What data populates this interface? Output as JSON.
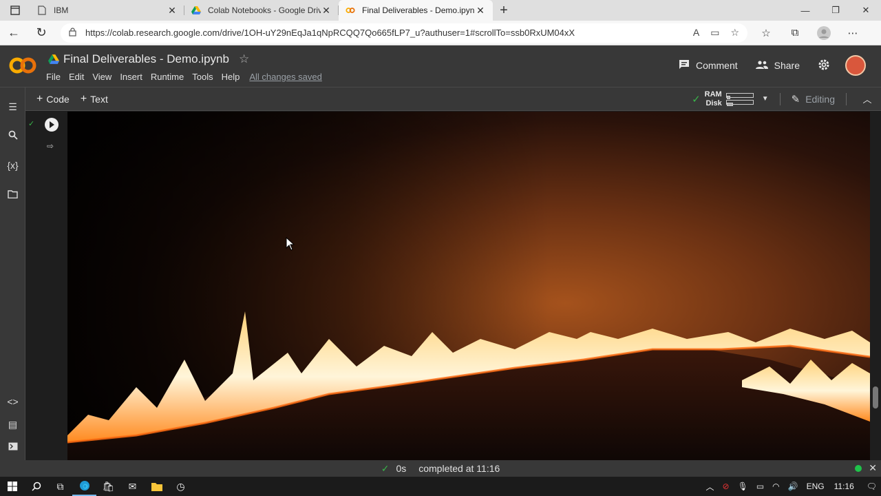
{
  "browser": {
    "tabs": [
      {
        "title": "IBM",
        "active": false
      },
      {
        "title": "Colab Notebooks - Google Drive",
        "active": false
      },
      {
        "title": "Final Deliverables - Demo.ipynb",
        "active": true
      }
    ],
    "new_tab": "+",
    "url": "https://colab.research.google.com/drive/1OH-uY29nEqJa1qNpRCQQ7Qo665fLP7_u?authuser=1#scrollTo=ssb0RxUM04xX"
  },
  "colab": {
    "logo_text": "CO",
    "notebook_title": "Final Deliverables - Demo.ipynb",
    "menu": [
      "File",
      "Edit",
      "View",
      "Insert",
      "Runtime",
      "Tools",
      "Help"
    ],
    "save_status": "All changes saved",
    "comment_label": "Comment",
    "share_label": "Share",
    "add_code_label": "Code",
    "add_text_label": "Text",
    "ram_label": "RAM",
    "disk_label": "Disk",
    "editing_label": "Editing"
  },
  "cell": {
    "output_type": "video-frame-fire"
  },
  "status": {
    "duration": "0s",
    "message": "completed at 11:16"
  },
  "taskbar": {
    "language": "ENG",
    "time": "11:16"
  },
  "colors": {
    "colab_orange": "#f9ab00",
    "colab_bg": "#383838",
    "success_green": "#39b54a"
  }
}
